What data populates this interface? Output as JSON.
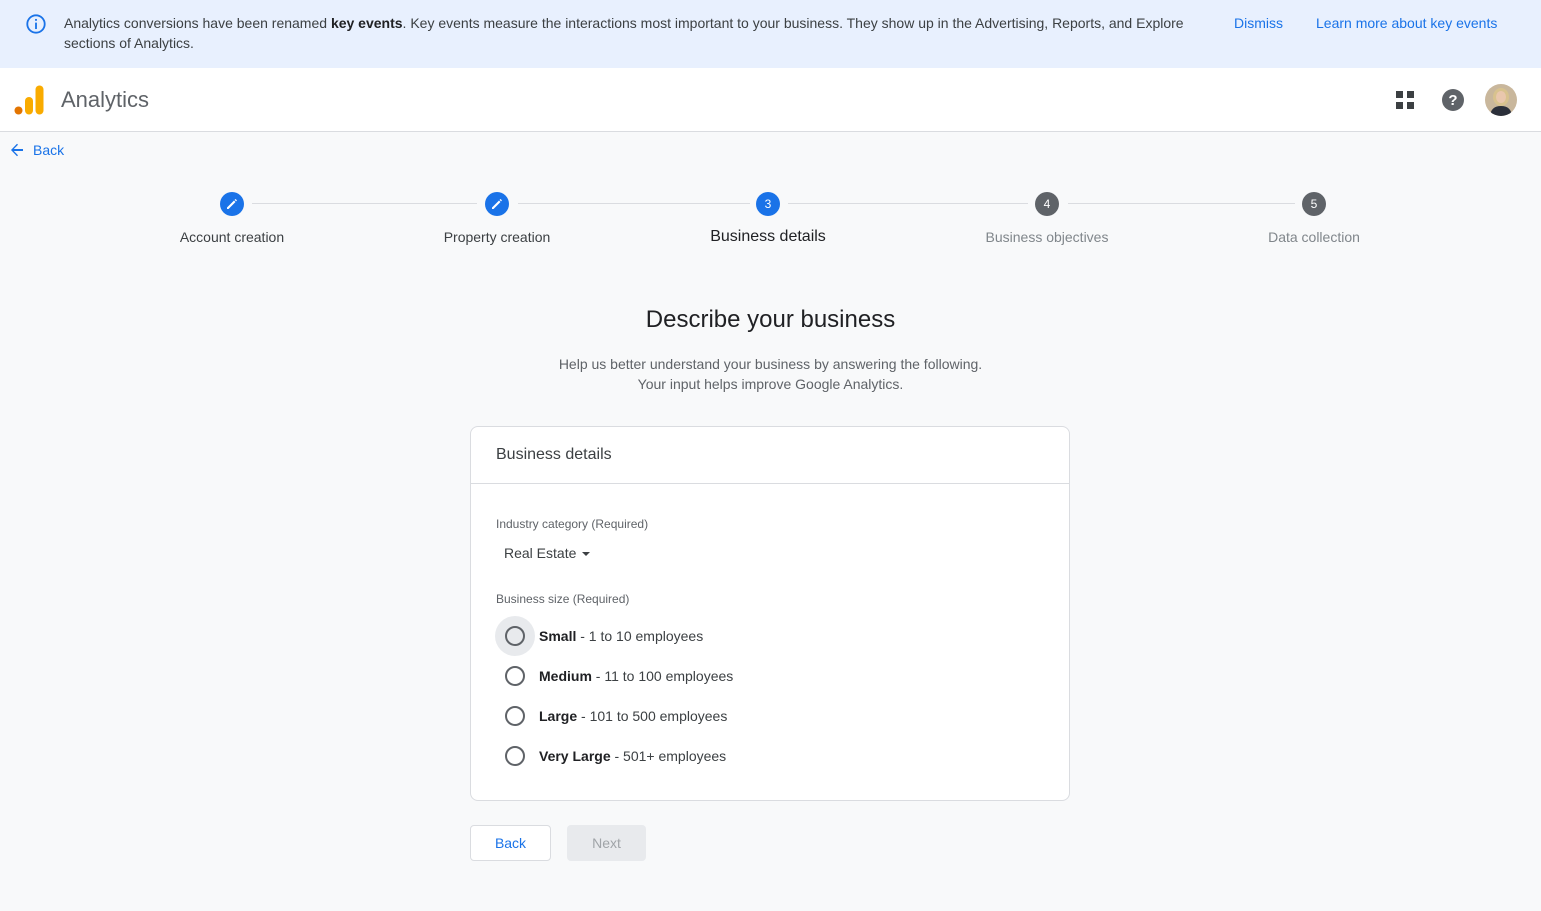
{
  "banner": {
    "message_pre": "Analytics conversions have been renamed ",
    "message_bold": "key events",
    "message_post": ". Key events measure the interactions most important to your business. They show up in the Advertising, Reports, and Explore sections of Analytics.",
    "dismiss_label": "Dismiss",
    "learn_more_label": "Learn more about key events",
    "icon": "info-icon"
  },
  "header": {
    "app_title": "Analytics",
    "icons": [
      "apps-grid-icon",
      "help-icon",
      "user-avatar"
    ]
  },
  "back_link": {
    "label": "Back"
  },
  "stepper": {
    "steps": [
      {
        "number": "1",
        "label": "Account creation",
        "state": "done"
      },
      {
        "number": "2",
        "label": "Property creation",
        "state": "done"
      },
      {
        "number": "3",
        "label": "Business details",
        "state": "active"
      },
      {
        "number": "4",
        "label": "Business objectives",
        "state": "todo"
      },
      {
        "number": "5",
        "label": "Data collection",
        "state": "todo"
      }
    ]
  },
  "intro": {
    "title": "Describe your business",
    "subtitle_line1": "Help us better understand your business by answering the following.",
    "subtitle_line2": "Your input helps improve Google Analytics."
  },
  "card": {
    "title": "Business details",
    "industry": {
      "label": "Industry category (Required)",
      "selected": "Real Estate"
    },
    "size": {
      "label": "Business size (Required)",
      "options": [
        {
          "name": "Small",
          "detail": " - 1 to 10 employees",
          "selected": false
        },
        {
          "name": "Medium",
          "detail": " - 11 to 100 employees",
          "selected": false
        },
        {
          "name": "Large",
          "detail": " - 101 to 500 employees",
          "selected": false
        },
        {
          "name": "Very Large",
          "detail": " - 501+ employees",
          "selected": false
        }
      ]
    }
  },
  "footer": {
    "back_label": "Back",
    "next_label": "Next",
    "next_disabled": true
  },
  "colors": {
    "accent": "#1a73e8",
    "banner_bg": "#e8f0fe",
    "logo_orange": "#f9ab00",
    "logo_dark_orange": "#e37400"
  }
}
